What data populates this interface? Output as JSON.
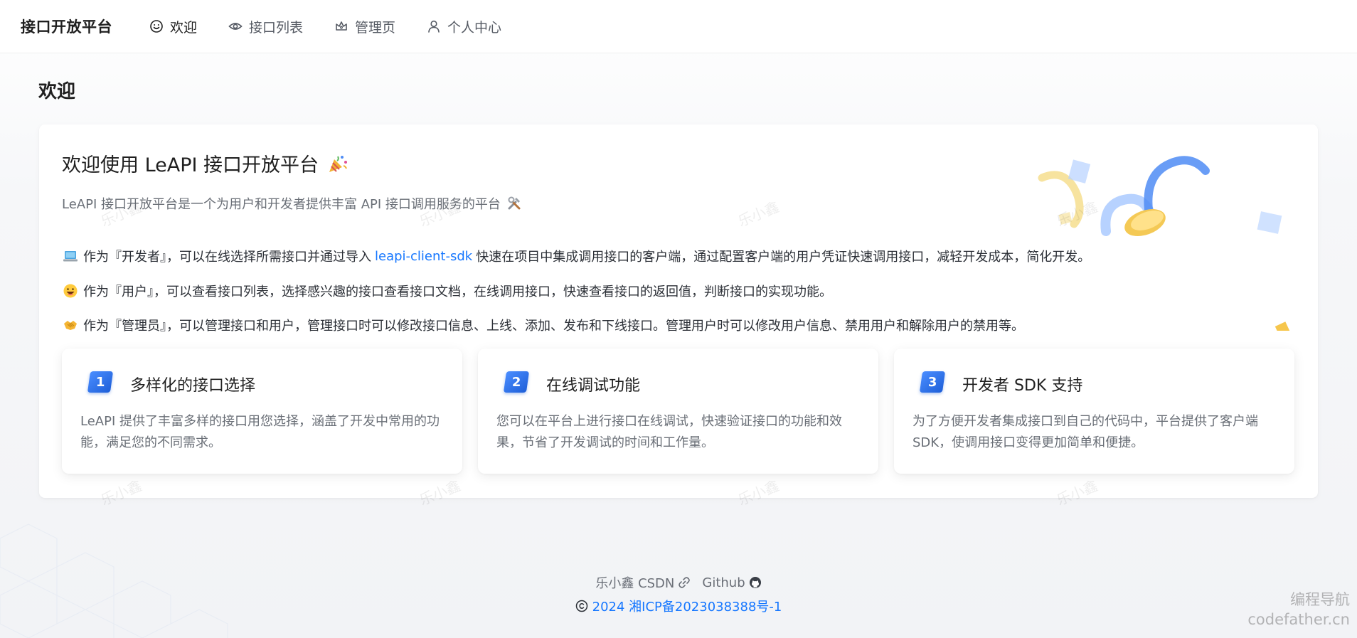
{
  "header": {
    "brand": "接口开放平台",
    "nav": [
      {
        "label": "欢迎",
        "icon": "smile-icon"
      },
      {
        "label": "接口列表",
        "icon": "eye-icon"
      },
      {
        "label": "管理页",
        "icon": "crown-icon"
      },
      {
        "label": "个人中心",
        "icon": "user-icon"
      }
    ]
  },
  "page": {
    "title": "欢迎"
  },
  "card": {
    "title": "欢迎使用 LeAPI 接口开放平台",
    "desc": "LeAPI 接口开放平台是一个为用户和开发者提供丰富 API 接口调用服务的平台",
    "developer": {
      "before": "作为『开发者』，可以在线选择所需接口并通过导入",
      "link": "leapi-client-sdk",
      "after": "快速在项目中集成调用接口的客户端，通过配置客户端的用户凭证快速调用接口，减轻开发成本，简化开发。"
    },
    "user": "作为『用户』，可以查看接口列表，选择感兴趣的接口查看接口文档，在线调用接口，快速查看接口的返回值，判断接口的实现功能。",
    "admin": "作为『管理员』，可以管理接口和用户，管理接口时可以修改接口信息、上线、添加、发布和下线接口。管理用户时可以修改用户信息、禁用用户和解除用户的禁用等。",
    "features": [
      {
        "num": "1",
        "title": "多样化的接口选择",
        "desc": "LeAPI 提供了丰富多样的接口用您选择，涵盖了开发中常用的功能，满足您的不同需求。"
      },
      {
        "num": "2",
        "title": "在线调试功能",
        "desc": "您可以在平台上进行接口在线调试，快速验证接口的功能和效果，节省了开发调试的时间和工作量。"
      },
      {
        "num": "3",
        "title": "开发者 SDK 支持",
        "desc": "为了方便开发者集成接口到自己的代码中，平台提供了客户端 SDK，使调用接口变得更加简单和便捷。"
      }
    ]
  },
  "watermark": "乐小鑫",
  "footer": {
    "link1": "乐小鑫 CSDN",
    "link2": "Github",
    "copyright": "2024 湘ICP备2023038388号-1"
  },
  "corner": {
    "line1": "编程导航",
    "line2": "codefather.cn"
  },
  "colors": {
    "accent": "#1677ff",
    "feature_badge": "#2f6fe8"
  }
}
